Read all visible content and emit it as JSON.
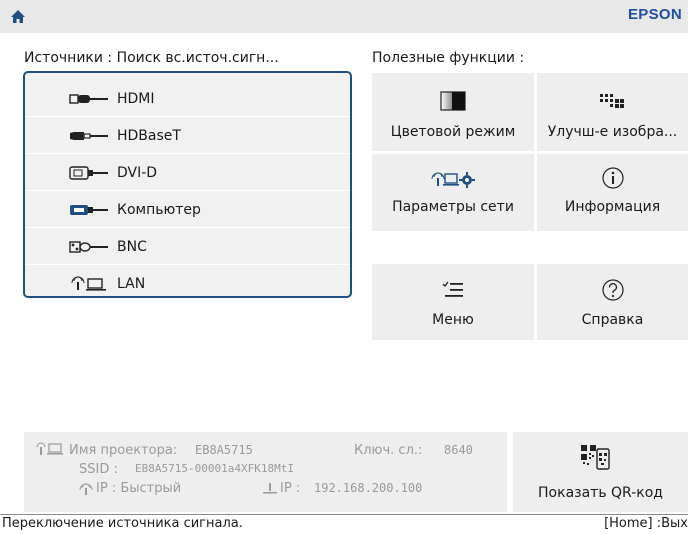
{
  "header": {
    "brand": "EPSON",
    "home_icon": "home-icon"
  },
  "sources": {
    "title": "Источники : Поиск вс.источ.сигн...",
    "items": [
      {
        "label": "HDMI",
        "icon": "hdmi-connector-icon"
      },
      {
        "label": "HDBaseT",
        "icon": "hdbaset-connector-icon"
      },
      {
        "label": "DVI-D",
        "icon": "dvi-connector-icon"
      },
      {
        "label": "Компьютер",
        "icon": "vga-connector-icon"
      },
      {
        "label": "BNC",
        "icon": "bnc-connector-icon"
      },
      {
        "label": "LAN",
        "icon": "lan-icon"
      }
    ]
  },
  "functions": {
    "title": "Полезные функции :",
    "items": [
      {
        "label": "Цветовой режим",
        "icon": "color-mode-icon"
      },
      {
        "label": "Улучш-е изобра...",
        "icon": "image-enhance-icon"
      },
      {
        "label": "Параметры сети",
        "icon": "network-settings-icon"
      },
      {
        "label": "Информация",
        "icon": "info-icon"
      },
      {
        "label": "Меню",
        "icon": "menu-icon"
      },
      {
        "label": "Справка",
        "icon": "help-icon"
      }
    ]
  },
  "network_info": {
    "projector_name_label": "Имя проектора:",
    "projector_name_value": "EB8A5715",
    "key_label": "Ключ. сл.:",
    "key_value": "8640",
    "ssid_label": "SSID :",
    "ssid_value": "EB8A5715-00001a4XFK18MtI",
    "ip_mode_label": "IP : Быстрый",
    "ip_label": "IP :",
    "ip_value": "192.168.200.100"
  },
  "qr": {
    "label": "Показать QR-код",
    "icon": "qr-code-icon"
  },
  "status": {
    "message": "Переключение источника сигнала.",
    "hint": "[Home] :Вых"
  },
  "colors": {
    "accent": "#1f4f83",
    "brand": "#1f4fa0",
    "tile_bg": "#eeeeee",
    "muted": "#9a9a9a"
  }
}
